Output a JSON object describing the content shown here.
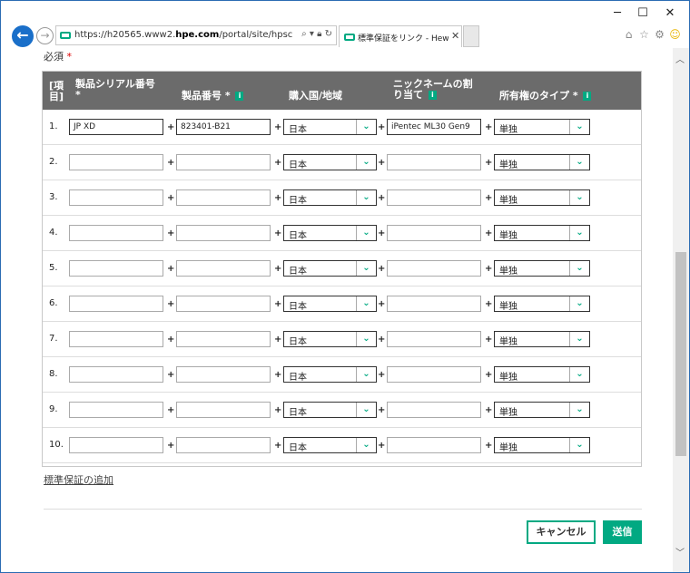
{
  "browser": {
    "url_prefix": "https://h20565.www2.",
    "url_domain": "hpe.com",
    "url_suffix": "/portal/site/hpsc/aae/linkWarranties",
    "tab_title": "標準保証をリンク - Hewlett P...",
    "window_min": "─",
    "window_max": "☐",
    "window_close": "✕",
    "tab_close": "✕"
  },
  "form": {
    "required_label": "必須",
    "required_star": "*",
    "headers": {
      "item": "[項目]",
      "serial": "製品シリアル番号",
      "serial_star": "*",
      "product": "製品番号",
      "product_star": "*",
      "country": "購入国/地域",
      "nickname_line1": "ニックネームの割",
      "nickname_line2": "り当て",
      "ownership": "所有権のタイプ",
      "ownership_star": "*"
    },
    "rows": [
      {
        "num": "1.",
        "serial": "JP           XD",
        "product": "823401-B21",
        "country": "日本",
        "nickname": "iPentec ML30 Gen9",
        "ownership": "単独"
      },
      {
        "num": "2.",
        "serial": "",
        "product": "",
        "country": "日本",
        "nickname": "",
        "ownership": "単独"
      },
      {
        "num": "3.",
        "serial": "",
        "product": "",
        "country": "日本",
        "nickname": "",
        "ownership": "単独"
      },
      {
        "num": "4.",
        "serial": "",
        "product": "",
        "country": "日本",
        "nickname": "",
        "ownership": "単独"
      },
      {
        "num": "5.",
        "serial": "",
        "product": "",
        "country": "日本",
        "nickname": "",
        "ownership": "単独"
      },
      {
        "num": "6.",
        "serial": "",
        "product": "",
        "country": "日本",
        "nickname": "",
        "ownership": "単独"
      },
      {
        "num": "7.",
        "serial": "",
        "product": "",
        "country": "日本",
        "nickname": "",
        "ownership": "単独"
      },
      {
        "num": "8.",
        "serial": "",
        "product": "",
        "country": "日本",
        "nickname": "",
        "ownership": "単独"
      },
      {
        "num": "9.",
        "serial": "",
        "product": "",
        "country": "日本",
        "nickname": "",
        "ownership": "単独"
      },
      {
        "num": "10.",
        "serial": "",
        "product": "",
        "country": "日本",
        "nickname": "",
        "ownership": "単独"
      }
    ],
    "plus": "+",
    "add_link": "標準保証の追加",
    "cancel": "キャンセル",
    "submit": "送信"
  },
  "colors": {
    "accent": "#01a982",
    "header_bg": "#6b6b6b",
    "browser_blue": "#1a6fc9"
  }
}
